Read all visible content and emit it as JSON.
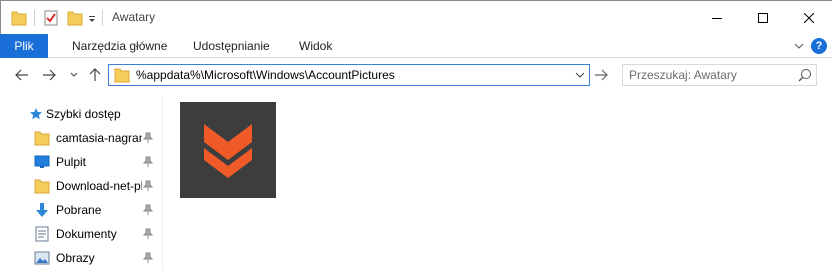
{
  "window": {
    "title": "Awatary"
  },
  "ribbon": {
    "tabs": [
      {
        "label": "Plik"
      },
      {
        "label": "Narzędzia główne"
      },
      {
        "label": "Udostępnianie"
      },
      {
        "label": "Widok"
      }
    ],
    "help_label": "?"
  },
  "address_bar": {
    "path": "%appdata%\\Microsoft\\Windows\\AccountPictures"
  },
  "search": {
    "placeholder": "Przeszukaj: Awatary"
  },
  "nav_pane": {
    "quick_access_label": "Szybki dostęp",
    "items": [
      {
        "label": "camtasia-nagrania",
        "icon": "folder-icon",
        "pinned": true
      },
      {
        "label": "Pulpit",
        "icon": "desktop-icon",
        "pinned": true
      },
      {
        "label": "Download-net-pl",
        "icon": "folder-icon",
        "pinned": true
      },
      {
        "label": "Pobrane",
        "icon": "download-arrow-icon",
        "pinned": true
      },
      {
        "label": "Dokumenty",
        "icon": "documents-icon",
        "pinned": true
      },
      {
        "label": "Obrazy",
        "icon": "pictures-icon",
        "pinned": true
      }
    ]
  },
  "content": {
    "items": [
      {
        "type": "image",
        "icon": "orange-chevron-avatar"
      }
    ]
  },
  "colors": {
    "accent": "#1a6ed8",
    "address_border": "#3b7fd6",
    "thumb_bg": "#3d3d3d",
    "chevron": "#f05a28"
  }
}
